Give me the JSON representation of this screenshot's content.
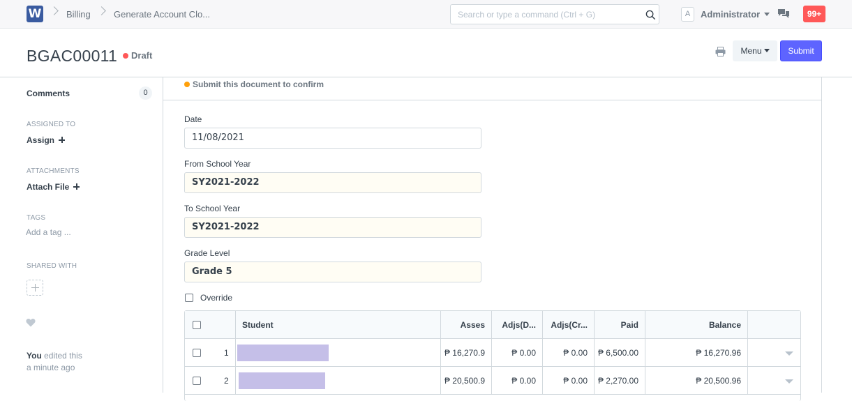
{
  "navbar": {
    "logo": "W",
    "breadcrumbs": [
      "Billing",
      "Generate Account Clo..."
    ],
    "search_placeholder": "Search or type a command (Ctrl + G)",
    "avatar": "A",
    "user": "Administrator",
    "notifications": "99+"
  },
  "page": {
    "title": "BGAC00011",
    "status": "Draft",
    "menu_label": "Menu",
    "submit_label": "Submit"
  },
  "sidebar": {
    "comments_label": "Comments",
    "comments_count": "0",
    "assigned_to_label": "ASSIGNED TO",
    "assign_label": "Assign",
    "attachments_label": "ATTACHMENTS",
    "attach_label": "Attach File",
    "tags_label": "TAGS",
    "add_tag": "Add a tag ...",
    "shared_label": "SHARED WITH",
    "edit_user": "You",
    "edit_action": "edited this",
    "edit_time": "a minute ago"
  },
  "form": {
    "message": "Submit this document to confirm",
    "date_label": "Date",
    "date_value": "11/08/2021",
    "from_label": "From School Year",
    "from_value": "SY2021-2022",
    "to_label": "To School Year",
    "to_value": "SY2021-2022",
    "grade_label": "Grade Level",
    "grade_value": "Grade 5",
    "override_label": "Override"
  },
  "grid": {
    "headers": {
      "student": "Student",
      "asses": "Asses",
      "adjs_d": "Adjs(D...",
      "adjs_c": "Adjs(Cr...",
      "paid": "Paid",
      "balance": "Balance"
    },
    "rows": [
      {
        "idx": "1",
        "asses": "₱ 16,270.9",
        "adjs_d": "₱ 0.00",
        "adjs_c": "₱ 0.00",
        "paid": "₱ 6,500.00",
        "balance": "₱ 16,270.96"
      },
      {
        "idx": "2",
        "asses": "₱ 20,500.9",
        "adjs_d": "₱ 0.00",
        "adjs_c": "₱ 0.00",
        "paid": "₱ 2,270.00",
        "balance": "₱ 20,500.96"
      }
    ]
  }
}
